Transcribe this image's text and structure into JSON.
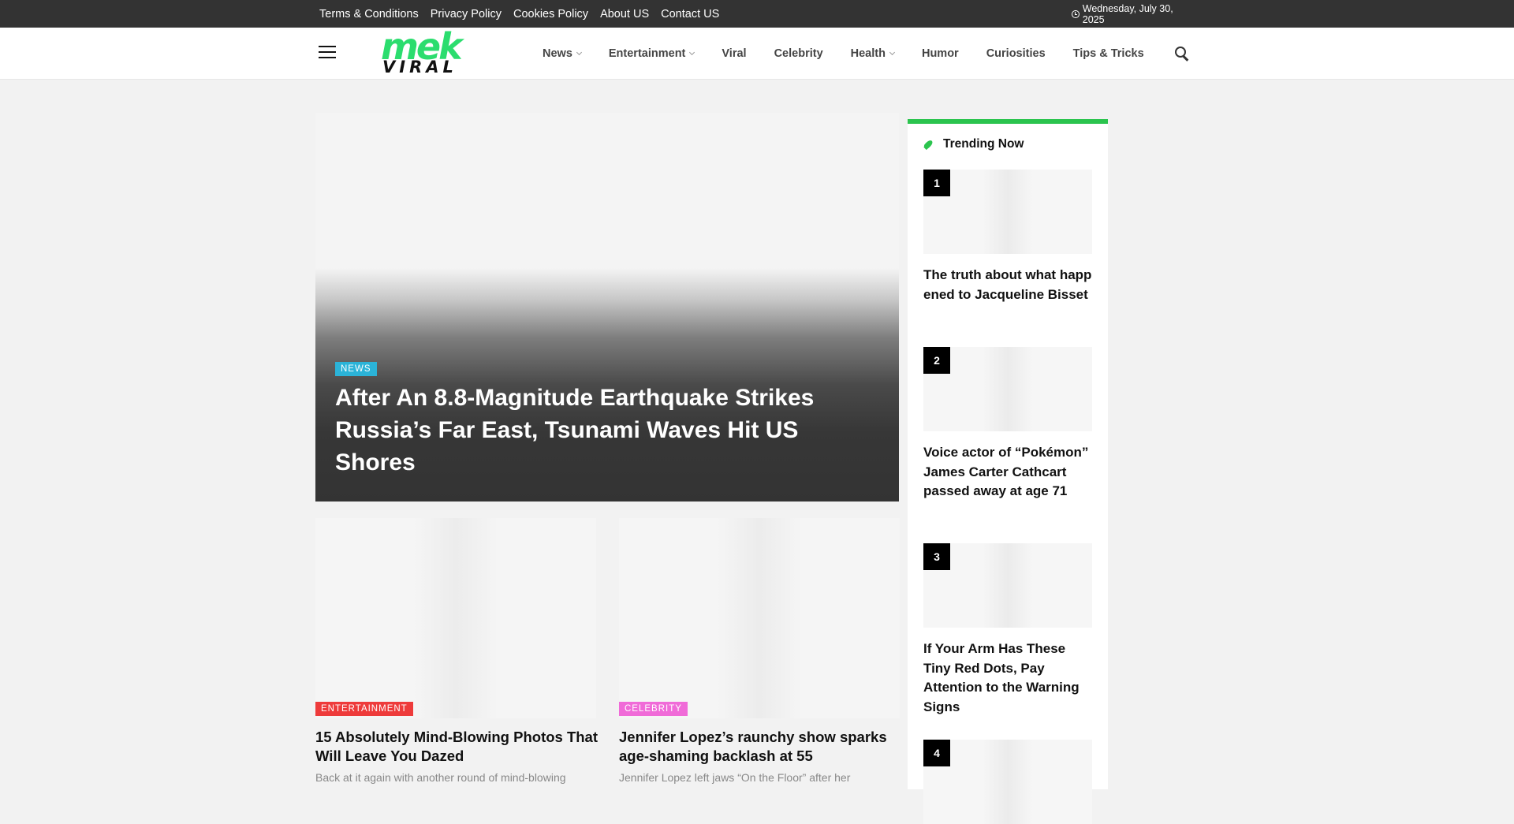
{
  "topbar": {
    "links": [
      "Terms & Conditions",
      "Privacy Policy",
      "Cookies Policy",
      "About US",
      "Contact US"
    ],
    "date": "Wednesday, July 30, 2025"
  },
  "header": {
    "logo_top": "mek",
    "logo_bottom": "VIRAL",
    "nav": [
      {
        "label": "News",
        "has_dropdown": true
      },
      {
        "label": "Entertainment",
        "has_dropdown": true
      },
      {
        "label": "Viral",
        "has_dropdown": false
      },
      {
        "label": "Celebrity",
        "has_dropdown": false
      },
      {
        "label": "Health",
        "has_dropdown": true
      },
      {
        "label": "Humor",
        "has_dropdown": false
      },
      {
        "label": "Curiosities",
        "has_dropdown": false
      },
      {
        "label": "Tips & Tricks",
        "has_dropdown": false
      }
    ]
  },
  "hero": {
    "category": "NEWS",
    "title": "After An 8.8-Magnitude Earthquake Strikes Russia’s Far East, Tsunami Waves Hit US Shores"
  },
  "cards": [
    {
      "category": "ENTERTAINMENT",
      "title": "15 Absolutely Mind-Blowing Photos That Will Leave You Dazed",
      "excerpt": "Back at it again with another round of mind-blowing"
    },
    {
      "category": "CELEBRITY",
      "title": "Jennifer Lopez’s raunchy show sparks age-shaming backlash at 55",
      "excerpt": "Jennifer Lopez left jaws “On the Floor” after her"
    }
  ],
  "sidebar": {
    "title": "Trending Now",
    "items": [
      {
        "rank": "1",
        "title": "The truth about what happened to Jacqueline Bisset"
      },
      {
        "rank": "2",
        "title": "Voice actor of “Pokémon” James Carter Cathcart passed away at age 71"
      },
      {
        "rank": "3",
        "title": "If Your Arm Has These Tiny Red Dots, Pay Attention to the Warning Signs"
      },
      {
        "rank": "4",
        "title": ""
      }
    ]
  },
  "colors": {
    "topbar": "#333333",
    "logo_green": "#2bdd6e",
    "sidebar_accent": "#2bc44e",
    "badge_news": "#2bb3d8",
    "badge_entertainment": "#ee3b3b",
    "badge_celebrity": "#f06bd8"
  },
  "icons": {
    "menu": "hamburger-icon",
    "search": "search-icon",
    "clock": "clock-icon",
    "trending": "rocket-icon"
  }
}
